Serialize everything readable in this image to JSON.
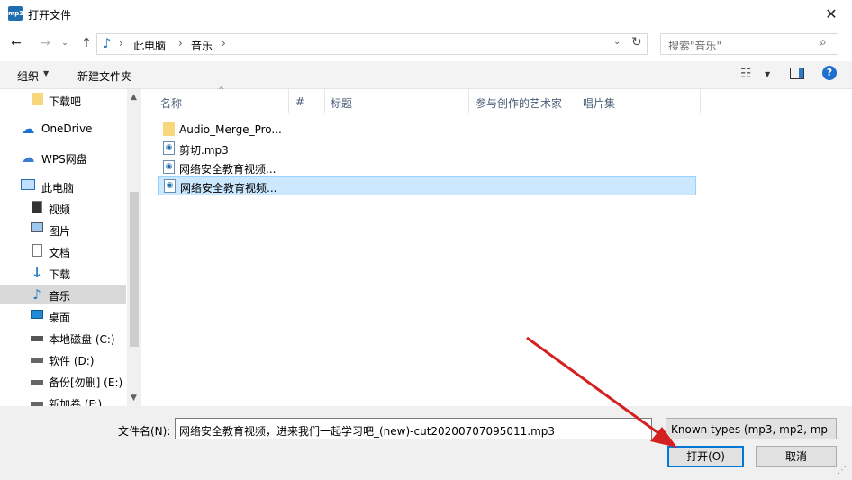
{
  "window": {
    "app_icon_text": "mp3",
    "title": "打开文件",
    "close_glyph": "✕"
  },
  "nav": {
    "back_glyph": "←",
    "forward_glyph": "→",
    "recent_glyph": "⌄",
    "up_glyph": "↑",
    "breadcrumbs": [
      "此电脑",
      "音乐"
    ],
    "crumb_sep": "›",
    "dropdown_glyph": "⌄",
    "refresh_glyph": "↻",
    "search_placeholder": "搜索\"音乐\"",
    "search_glyph": "⌕"
  },
  "toolbar": {
    "organize": "组织",
    "arrow": "▼",
    "new_folder": "新建文件夹",
    "help": "?"
  },
  "sidebar": {
    "items": [
      {
        "label": "下载吧",
        "icon": "folder-icon"
      },
      {
        "label": "OneDrive",
        "icon": "cloud-icon"
      },
      {
        "label": "WPS网盘",
        "icon": "wps-cloud-icon"
      },
      {
        "label": "此电脑",
        "icon": "computer-icon"
      },
      {
        "label": "视频",
        "icon": "video-icon"
      },
      {
        "label": "图片",
        "icon": "picture-icon"
      },
      {
        "label": "文档",
        "icon": "document-icon"
      },
      {
        "label": "下载",
        "icon": "download-icon"
      },
      {
        "label": "音乐",
        "icon": "music-icon"
      },
      {
        "label": "桌面",
        "icon": "desktop-icon"
      },
      {
        "label": "本地磁盘 (C:)",
        "icon": "drive-c-icon"
      },
      {
        "label": "软件 (D:)",
        "icon": "drive-icon"
      },
      {
        "label": "备份[勿删] (E:)",
        "icon": "drive-icon"
      },
      {
        "label": "新加卷 (F:)",
        "icon": "drive-icon"
      }
    ],
    "scroll_up": "▲",
    "scroll_down": "▼"
  },
  "columns": [
    "名称",
    "#",
    "标题",
    "参与创作的艺术家",
    "唱片集"
  ],
  "sort_glyph": "^",
  "files": [
    {
      "name": "Audio_Merge_Pro...",
      "type": "folder"
    },
    {
      "name": "剪切.mp3",
      "type": "audio"
    },
    {
      "name": "网络安全教育视频...",
      "type": "audio"
    },
    {
      "name": "网络安全教育视频...",
      "type": "audio"
    }
  ],
  "bottom": {
    "filename_label": "文件名(N):",
    "filename_value": "网络安全教育视频，进来我们一起学习吧_(new)-cut20200707095011.mp3",
    "filter_value": "Known types (mp3, mp2, mp",
    "open_button": "打开(O)",
    "cancel_button": "取消"
  },
  "colors": {
    "accent": "#0078d7",
    "selection": "#cce8ff",
    "annotation_arrow": "#e02020"
  }
}
